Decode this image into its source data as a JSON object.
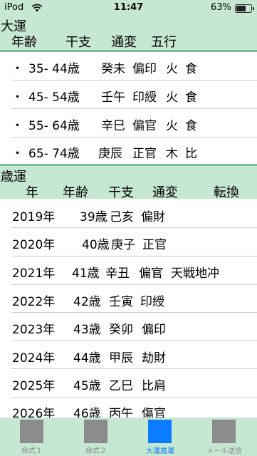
{
  "status": {
    "carrier": "iPod",
    "time": "11:47",
    "battery": "63%",
    "battery_level": 0.63
  },
  "daiun": {
    "title": "大運",
    "headers": [
      "年齢",
      "干支",
      "通変",
      "五行"
    ],
    "rows": [
      {
        "bullet": "・",
        "age": "35- 44歳",
        "kanshi": "癸未",
        "tsuhen": "偏印",
        "e1": "火",
        "e2": "食"
      },
      {
        "bullet": "・",
        "age": "45- 54歳",
        "kanshi": "壬午",
        "tsuhen": "印綬",
        "e1": "火",
        "e2": "食"
      },
      {
        "bullet": "・",
        "age": "55- 64歳",
        "kanshi": "辛巳",
        "tsuhen": "偏官",
        "e1": "火",
        "e2": "食"
      },
      {
        "bullet": "・",
        "age": "65- 74歳",
        "kanshi": "庚辰",
        "tsuhen": "正官",
        "e1": "木",
        "e2": "比"
      }
    ]
  },
  "saiun": {
    "title": "歳運",
    "headers": [
      "年",
      "年齢",
      "干支",
      "通変",
      "転換"
    ],
    "rows": [
      {
        "year": "2019年",
        "age": "39歳",
        "kanshi": "己亥",
        "tsuhen": "偏財",
        "tenkan": ""
      },
      {
        "year": "2020年",
        "age": "40歳",
        "kanshi": "庚子",
        "tsuhen": "正官",
        "tenkan": ""
      },
      {
        "year": "2021年",
        "age": "41歳",
        "kanshi": "辛丑",
        "tsuhen": "偏官",
        "tenkan": "天戦地冲"
      },
      {
        "year": "2022年",
        "age": "42歳",
        "kanshi": "壬寅",
        "tsuhen": "印綬",
        "tenkan": ""
      },
      {
        "year": "2023年",
        "age": "43歳",
        "kanshi": "癸卯",
        "tsuhen": "偏印",
        "tenkan": ""
      },
      {
        "year": "2024年",
        "age": "44歳",
        "kanshi": "甲辰",
        "tsuhen": "劫財",
        "tenkan": ""
      },
      {
        "year": "2025年",
        "age": "45歳",
        "kanshi": "乙巳",
        "tsuhen": "比肩",
        "tenkan": ""
      },
      {
        "year": "2026年",
        "age": "46歳",
        "kanshi": "丙午",
        "tsuhen": "傷官",
        "tenkan": ""
      }
    ]
  },
  "tabs": [
    {
      "label": "命式１",
      "active": false
    },
    {
      "label": "命式２",
      "active": false
    },
    {
      "label": "大運歳運",
      "active": true
    },
    {
      "label": "メール送信",
      "active": false
    }
  ]
}
